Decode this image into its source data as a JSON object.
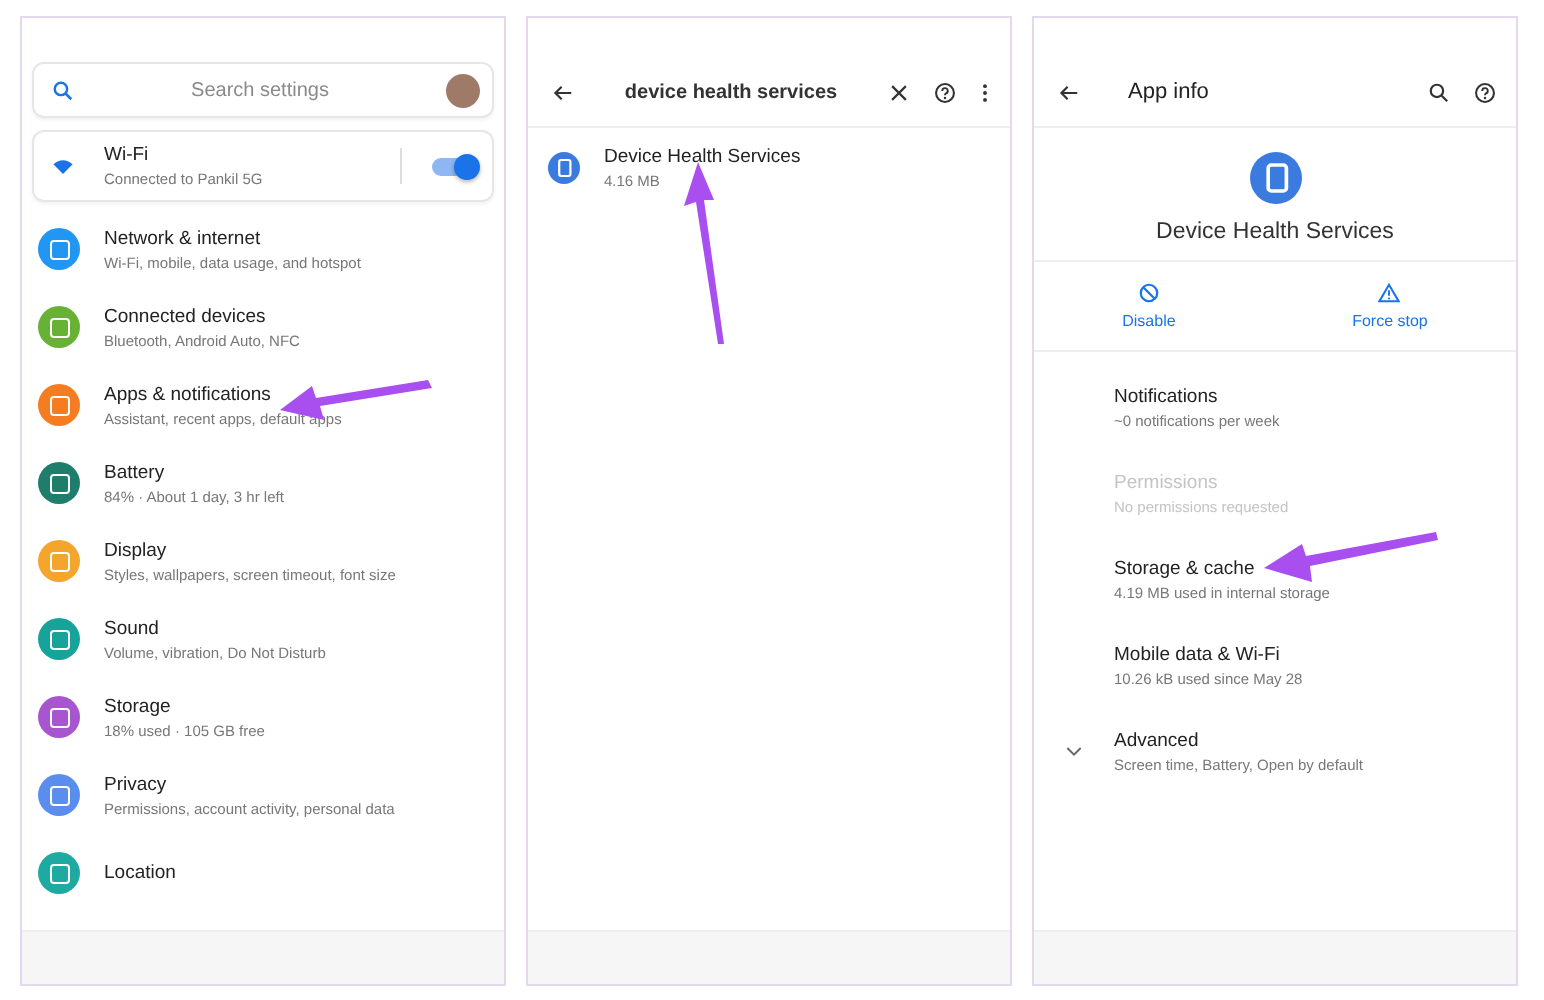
{
  "settings_panel": {
    "search": {
      "placeholder": "Search settings"
    },
    "wifi": {
      "title": "Wi-Fi",
      "subtitle": "Connected to Pankil 5G",
      "on": true
    },
    "items": [
      {
        "title": "Network & internet",
        "subtitle": "Wi-Fi, mobile, data usage, and hotspot",
        "color": "#2196f3"
      },
      {
        "title": "Connected devices",
        "subtitle": "Bluetooth, Android Auto, NFC",
        "color": "#67b234"
      },
      {
        "title": "Apps & notifications",
        "subtitle": "Assistant, recent apps, default apps",
        "color": "#f57c20"
      },
      {
        "title": "Battery",
        "subtitle": "84% · About 1 day, 3 hr left",
        "color": "#1f7d6c"
      },
      {
        "title": "Display",
        "subtitle": "Styles, wallpapers, screen timeout, font size",
        "color": "#f4a52c"
      },
      {
        "title": "Sound",
        "subtitle": "Volume, vibration, Do Not Disturb",
        "color": "#17a39a"
      },
      {
        "title": "Storage",
        "subtitle": "18% used · 105 GB free",
        "color": "#a855d0"
      },
      {
        "title": "Privacy",
        "subtitle": "Permissions, account activity, personal data",
        "color": "#5b8def"
      },
      {
        "title": "Location",
        "color": "#1eaaa0"
      }
    ]
  },
  "search_panel": {
    "query": "device health services",
    "results": [
      {
        "title": "Device Health Services",
        "size": "4.16 MB"
      }
    ]
  },
  "app_info_panel": {
    "title": "App info",
    "app_name": "Device Health Services",
    "actions": [
      {
        "label": "Disable",
        "kind": "disable"
      },
      {
        "label": "Force stop",
        "kind": "stop"
      }
    ],
    "items": [
      {
        "title": "Notifications",
        "subtitle": "~0 notifications per week",
        "disabled": false,
        "expandable": false
      },
      {
        "title": "Permissions",
        "subtitle": "No permissions requested",
        "disabled": true,
        "expandable": false
      },
      {
        "title": "Storage & cache",
        "subtitle": "4.19 MB used in internal storage",
        "disabled": false,
        "expandable": false
      },
      {
        "title": "Mobile data & Wi-Fi",
        "subtitle": "10.26 kB used since May 28",
        "disabled": false,
        "expandable": false
      },
      {
        "title": "Advanced",
        "subtitle": "Screen time, Battery, Open by default",
        "disabled": false,
        "expandable": true
      }
    ]
  }
}
